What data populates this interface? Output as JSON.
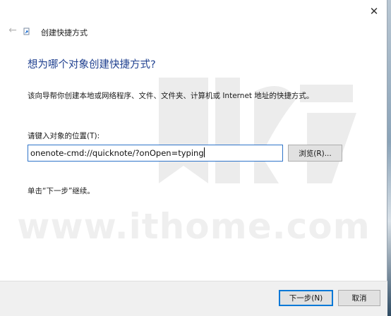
{
  "window": {
    "close_glyph": "✕"
  },
  "header": {
    "back_glyph": "←",
    "title": "创建快捷方式"
  },
  "main": {
    "heading": "想为哪个对象创建快捷方式?",
    "description": "该向导帮你创建本地或网络程序、文件、文件夹、计算机或 Internet 地址的快捷方式。",
    "location_label": "请键入对象的位置(T):",
    "location_value": "onenote-cmd://quicknote/?onOpen=typing",
    "browse_label": "浏览(R)...",
    "hint": "单击“下一步”继续。"
  },
  "watermark": {
    "text": "www.ithome.com"
  },
  "footer": {
    "next_label": "下一步(N)",
    "cancel_label": "取消"
  },
  "colors": {
    "heading": "#1e3f8f",
    "input_focus_border": "#2f74c9",
    "default_button_border": "#0078d7",
    "footer_bg": "#f0f0f0"
  },
  "icons": [
    "close-icon",
    "back-arrow-icon",
    "shortcut-wizard-icon"
  ]
}
